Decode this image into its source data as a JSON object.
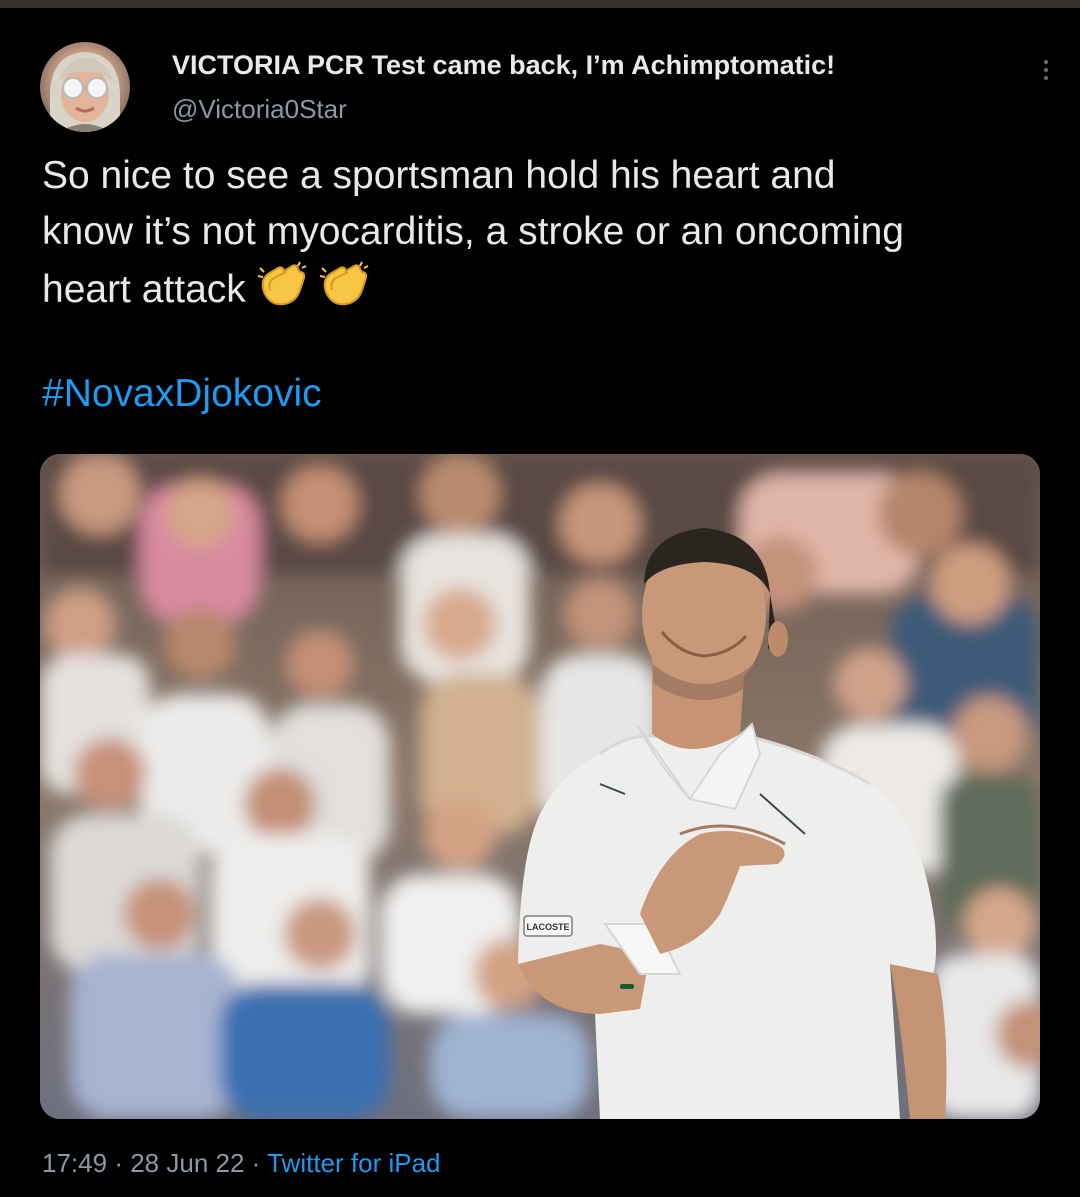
{
  "tweet": {
    "display_name": "VICTORIA PCR Test came back, I’m Achimptomatic!",
    "handle": "@Victoria0Star",
    "text_lines": [
      "So nice to see a sportsman hold his heart and",
      "know it’s not myocarditis, a stroke or an oncoming",
      "heart attack"
    ],
    "emojis": [
      "clapping-hands-icon",
      "clapping-hands-icon"
    ],
    "hashtag": "#NovaxDjokovic",
    "photo_brand_label": "LACOSTE",
    "time": "17:49",
    "separator": "·",
    "date": "28 Jun 22",
    "source": "Twitter for iPad"
  },
  "colors": {
    "background": "#000000",
    "text": "#e7e9ea",
    "muted": "#8b98a5",
    "link": "#1d9bf0"
  },
  "icons": {
    "more": "vertical-ellipsis-icon",
    "avatar": "profile-avatar"
  }
}
